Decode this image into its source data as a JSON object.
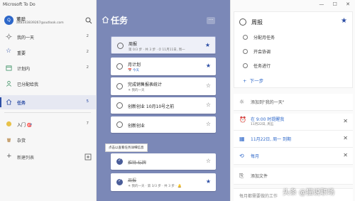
{
  "window": {
    "title": "Microsoft To Do",
    "buttons": "— ☐ ✕"
  },
  "profile": {
    "initial": "Q",
    "name": "董骅",
    "email": "alt8343839267@outlook.com"
  },
  "sidebar": {
    "items": [
      {
        "label": "我的一天",
        "count": "2",
        "icon": "sun-icon"
      },
      {
        "label": "重要",
        "count": "2",
        "icon": "star-icon"
      },
      {
        "label": "计划内",
        "count": "2",
        "icon": "calendar-icon"
      },
      {
        "label": "已分配给我",
        "count": "",
        "icon": "person-icon"
      },
      {
        "label": "任务",
        "count": "5",
        "icon": "home-icon"
      },
      {
        "label": "入门 🎯",
        "count": "7",
        "icon": "list-icon"
      },
      {
        "label": "杂货",
        "count": "",
        "icon": "list-icon"
      }
    ],
    "new_list": "新建列表"
  },
  "main": {
    "title": "任务",
    "tasks": [
      {
        "title": "周报",
        "meta": "第 0/3 步 · 共 3 步 · ⏱ 11月11日, 周一",
        "starred": true,
        "due_color": false
      },
      {
        "title": "月计划",
        "meta": "📅 今天",
        "starred": true,
        "due_color": true
      },
      {
        "title": "完成销售报表统计",
        "meta": "☀ 我的一天",
        "starred": false,
        "due_color": false
      },
      {
        "title": "创新创业 10月10号之前",
        "meta": "",
        "starred": false,
        "due_color": false
      },
      {
        "title": "创新创业",
        "meta": "",
        "starred": false,
        "due_color": false
      }
    ],
    "completed_label": "已完成",
    "tooltip": "点击以查看任务详细信息",
    "done_tasks": [
      {
        "title": "推特·标牌",
        "meta": "",
        "starred": false
      },
      {
        "title": "周报",
        "meta": "☀ 我的一天 · 第 3/3 步 · 共 3 步 · 🔔",
        "starred": true
      }
    ]
  },
  "detail": {
    "title": "周报",
    "steps": [
      "分配月任务",
      "开会协调",
      "任务进行"
    ],
    "add_step": "下一步",
    "my_day": "添加到\"我的一天\"",
    "reminder": "在 9:00 时提醒我",
    "reminder_sub": "11月22日, 周五",
    "due": "11月22日, 周一 到期",
    "repeat": "每月",
    "add_file": "添加文件",
    "note": "每月都需要做的工作"
  },
  "watermark": "头条 @猫说职场"
}
